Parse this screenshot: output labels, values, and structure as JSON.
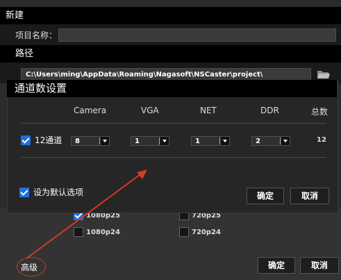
{
  "window": {
    "title": "新建"
  },
  "project": {
    "label": "项目名称：",
    "value": ""
  },
  "path": {
    "section_title": "路径",
    "value": "C:\\Users\\ming\\AppData\\Roaming\\Nagasoft\\NSCaster\\project\\"
  },
  "resolutions": [
    {
      "label": "1080p25",
      "checked": true
    },
    {
      "label": "720p25",
      "checked": false
    },
    {
      "label": "1080p24",
      "checked": false
    },
    {
      "label": "720p24",
      "checked": false
    }
  ],
  "footer": {
    "advanced_label": "高级",
    "ok_label": "确定",
    "cancel_label": "取消"
  },
  "dialog": {
    "title": "通道数设置",
    "columns": [
      "Camera",
      "VGA",
      "NET",
      "DDR",
      "总数"
    ],
    "channel_label": "12通道",
    "channel_checked": true,
    "values": [
      "8",
      "1",
      "1",
      "2"
    ],
    "total": "12",
    "default_label": "设为默认选项",
    "default_checked": true,
    "ok_label": "确定",
    "cancel_label": "取消"
  },
  "colors": {
    "accent": "#1f6fe0",
    "annotation": "#d43a2a"
  }
}
